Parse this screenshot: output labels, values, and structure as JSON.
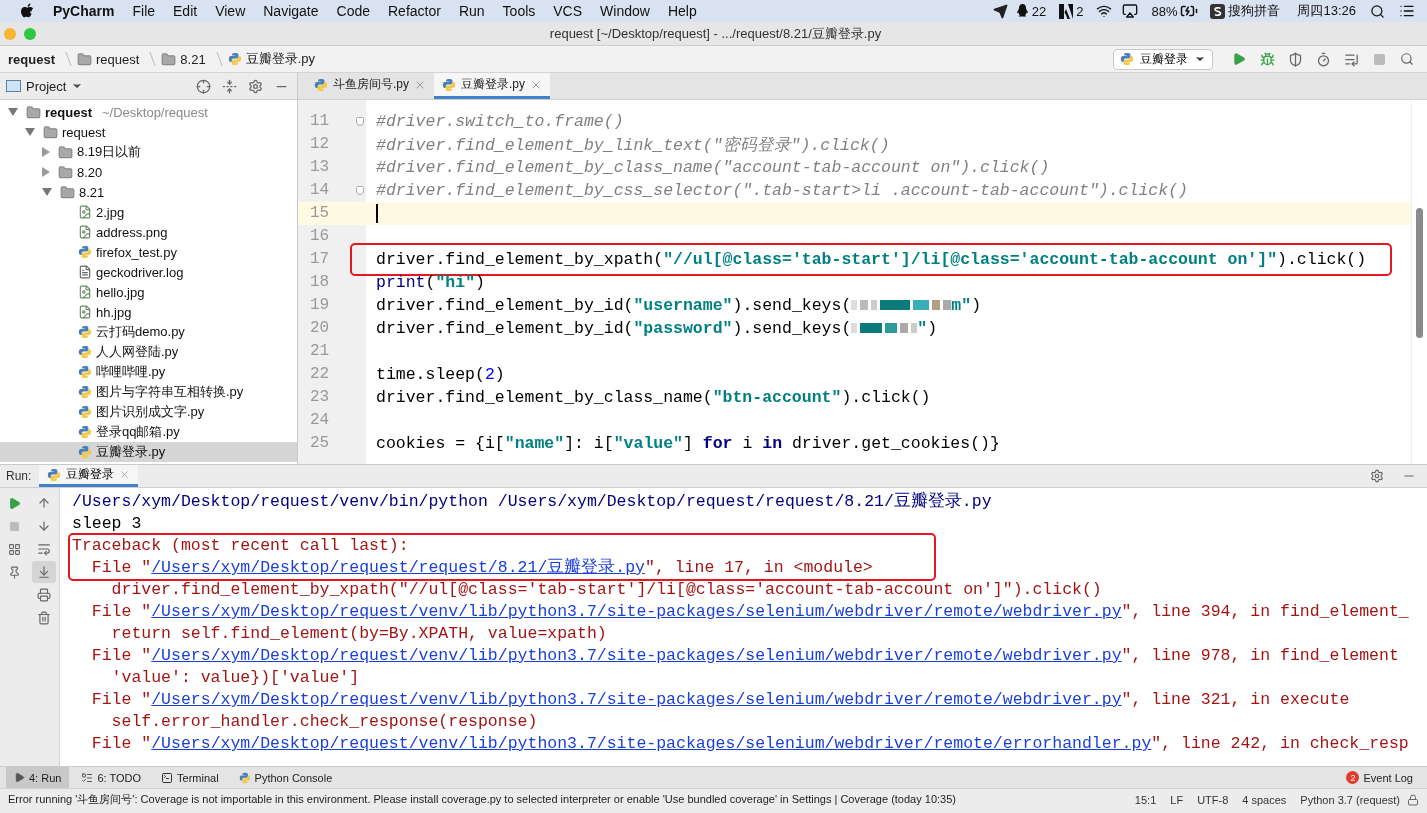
{
  "menu_bar": {
    "app": "PyCharm",
    "menus": [
      "File",
      "Edit",
      "View",
      "Navigate",
      "Code",
      "Refactor",
      "Run",
      "Tools",
      "VCS",
      "Window",
      "Help"
    ],
    "status": {
      "qq_count": "22",
      "adobe_count": "2",
      "battery": "88%",
      "input_method": "搜狗拼音",
      "clock": "周四13:26"
    }
  },
  "window": {
    "title": "request [~/Desktop/request] - .../request/8.21/豆瓣登录.py"
  },
  "breadcrumbs": [
    {
      "label": "request",
      "kind": "project"
    },
    {
      "label": "request",
      "kind": "folder"
    },
    {
      "label": "8.21",
      "kind": "folder"
    },
    {
      "label": "豆瓣登录.py",
      "kind": "python"
    }
  ],
  "run_config": {
    "label": "豆瓣登录"
  },
  "project_panel": {
    "title": "Project",
    "tree": [
      {
        "label": "request",
        "hint": "~/Desktop/request",
        "kind": "folder",
        "expanded": true,
        "selected": false,
        "children": [
          {
            "label": "request",
            "kind": "folder",
            "expanded": true,
            "selected": false,
            "children": [
              {
                "label": "8.19日以前",
                "kind": "folder",
                "expanded": false,
                "selected": false
              },
              {
                "label": "8.20",
                "kind": "folder",
                "expanded": false,
                "selected": false
              },
              {
                "label": "8.21",
                "kind": "folder",
                "expanded": true,
                "selected": false,
                "children": [
                  {
                    "label": "2.jpg",
                    "kind": "image",
                    "selected": false
                  },
                  {
                    "label": "address.png",
                    "kind": "image",
                    "selected": false
                  },
                  {
                    "label": "firefox_test.py",
                    "kind": "python",
                    "selected": false
                  },
                  {
                    "label": "geckodriver.log",
                    "kind": "log",
                    "selected": false
                  },
                  {
                    "label": "hello.jpg",
                    "kind": "image",
                    "selected": false
                  },
                  {
                    "label": "hh.jpg",
                    "kind": "image",
                    "selected": false
                  },
                  {
                    "label": "云打码demo.py",
                    "kind": "python",
                    "selected": false
                  },
                  {
                    "label": "人人网登陆.py",
                    "kind": "python",
                    "selected": false
                  },
                  {
                    "label": "哔哩哔哩.py",
                    "kind": "python",
                    "selected": false
                  },
                  {
                    "label": "图片与字符串互相转换.py",
                    "kind": "python",
                    "selected": false
                  },
                  {
                    "label": "图片识别成文字.py",
                    "kind": "python",
                    "selected": false
                  },
                  {
                    "label": "登录qq邮箱.py",
                    "kind": "python",
                    "selected": false
                  },
                  {
                    "label": "豆瓣登录.py",
                    "kind": "python",
                    "selected": true
                  }
                ]
              }
            ]
          }
        ]
      }
    ]
  },
  "editor": {
    "tabs": [
      {
        "label": "斗鱼房间号.py",
        "selected": false
      },
      {
        "label": "豆瓣登录.py",
        "selected": true
      }
    ],
    "lines": [
      {
        "number": "11",
        "fold": true,
        "current": false,
        "highlighted": false,
        "tokens": [
          {
            "kind": "comment",
            "text": "#driver.switch_to.frame()"
          }
        ]
      },
      {
        "number": "12",
        "fold": false,
        "current": false,
        "highlighted": false,
        "tokens": [
          {
            "kind": "comment",
            "text": "#driver.find_element_by_link_text(\"密码登录\").click()"
          }
        ]
      },
      {
        "number": "13",
        "fold": false,
        "current": false,
        "highlighted": false,
        "tokens": [
          {
            "kind": "comment",
            "text": "#driver.find_element_by_class_name(\"account-tab-account on\").click()"
          }
        ]
      },
      {
        "number": "14",
        "fold": true,
        "current": false,
        "highlighted": false,
        "tokens": [
          {
            "kind": "comment",
            "text": "#driver.find_element_by_css_selector(\".tab-start>li .account-tab-account\").click()"
          }
        ]
      },
      {
        "number": "15",
        "fold": false,
        "current": true,
        "highlighted": false
      },
      {
        "number": "16",
        "fold": false,
        "current": false,
        "highlighted": false
      },
      {
        "number": "17",
        "fold": false,
        "current": false,
        "highlighted": true,
        "tokens": [
          {
            "kind": "text",
            "text": "driver.find_element_by_xpath("
          },
          {
            "kind": "string",
            "text": "\"//ul[@class='tab-start']/li[@class='account-tab-account on']\""
          },
          {
            "kind": "text",
            "text": ").click()"
          }
        ]
      },
      {
        "number": "18",
        "fold": false,
        "current": false,
        "highlighted": false,
        "tokens": [
          {
            "kind": "builtin",
            "text": "print"
          },
          {
            "kind": "text",
            "text": "("
          },
          {
            "kind": "string",
            "text": "\"hi\""
          },
          {
            "kind": "text",
            "text": ")"
          }
        ]
      },
      {
        "number": "19",
        "fold": false,
        "current": false,
        "highlighted": false,
        "tokens": [
          {
            "kind": "text",
            "text": "driver.find_element_by_id("
          },
          {
            "kind": "string",
            "text": "\"username\""
          },
          {
            "kind": "text",
            "text": ").send_keys("
          },
          {
            "kind": "redacted",
            "wide": true
          },
          {
            "kind": "string",
            "text": "m\""
          },
          {
            "kind": "text",
            "text": ")"
          }
        ]
      },
      {
        "number": "20",
        "fold": false,
        "current": false,
        "highlighted": false,
        "tokens": [
          {
            "kind": "text",
            "text": "driver.find_element_by_id("
          },
          {
            "kind": "string",
            "text": "\"password\""
          },
          {
            "kind": "text",
            "text": ").send_keys("
          },
          {
            "kind": "redacted",
            "wide": false
          },
          {
            "kind": "string",
            "text": "\""
          },
          {
            "kind": "text",
            "text": ")"
          }
        ]
      },
      {
        "number": "21",
        "fold": false,
        "current": false,
        "highlighted": false
      },
      {
        "number": "22",
        "fold": false,
        "current": false,
        "highlighted": false,
        "tokens": [
          {
            "kind": "text",
            "text": "time.sleep("
          },
          {
            "kind": "number",
            "text": "2"
          },
          {
            "kind": "text",
            "text": ")"
          }
        ]
      },
      {
        "number": "23",
        "fold": false,
        "current": false,
        "highlighted": false,
        "tokens": [
          {
            "kind": "text",
            "text": "driver.find_element_by_class_name("
          },
          {
            "kind": "string",
            "text": "\"btn-account\""
          },
          {
            "kind": "text",
            "text": ").click()"
          }
        ]
      },
      {
        "number": "24",
        "fold": false,
        "current": false,
        "highlighted": false
      },
      {
        "number": "25",
        "fold": false,
        "current": false,
        "highlighted": false,
        "tokens": [
          {
            "kind": "text",
            "text": "cookies = {i["
          },
          {
            "kind": "string",
            "text": "\"name\""
          },
          {
            "kind": "text",
            "text": "]: i["
          },
          {
            "kind": "string",
            "text": "\"value\""
          },
          {
            "kind": "text",
            "text": "] "
          },
          {
            "kind": "keyword",
            "text": "for"
          },
          {
            "kind": "text",
            "text": " i "
          },
          {
            "kind": "keyword",
            "text": "in"
          },
          {
            "kind": "text",
            "text": " driver.get_cookies()}"
          }
        ]
      }
    ]
  },
  "run_panel": {
    "label": "Run:",
    "tab": {
      "label": "豆瓣登录"
    },
    "lines": [
      {
        "command": true,
        "error": false,
        "highlighted": false,
        "segments": [
          {
            "kind": "plain",
            "text": "/Users/xym/Desktop/request/venv/bin/python /Users/xym/Desktop/request/request/8.21/豆瓣登录.py"
          }
        ]
      },
      {
        "command": false,
        "error": false,
        "highlighted": false,
        "segments": [
          {
            "kind": "plain",
            "text": "sleep 3"
          }
        ]
      },
      {
        "command": false,
        "error": true,
        "highlighted": true,
        "segments": [
          {
            "kind": "plain",
            "text": "Traceback (most recent call last):"
          }
        ]
      },
      {
        "command": false,
        "error": true,
        "highlighted": true,
        "segments": [
          {
            "kind": "plain",
            "text": "  File \""
          },
          {
            "kind": "link",
            "text": "/Users/xym/Desktop/request/request/8.21/豆瓣登录.py"
          },
          {
            "kind": "plain",
            "text": "\", line 17, in <module>"
          }
        ]
      },
      {
        "command": false,
        "error": true,
        "highlighted": false,
        "segments": [
          {
            "kind": "plain",
            "text": "    driver.find_element_by_xpath(\"//ul[@class='tab-start']/li[@class='account-tab-account on']\").click()"
          }
        ]
      },
      {
        "command": false,
        "error": true,
        "highlighted": false,
        "segments": [
          {
            "kind": "plain",
            "text": "  File \""
          },
          {
            "kind": "link",
            "text": "/Users/xym/Desktop/request/venv/lib/python3.7/site-packages/selenium/webdriver/remote/webdriver.py"
          },
          {
            "kind": "plain",
            "text": "\", line 394, in find_element_"
          }
        ]
      },
      {
        "command": false,
        "error": true,
        "highlighted": false,
        "segments": [
          {
            "kind": "plain",
            "text": "    return self.find_element(by=By.XPATH, value=xpath)"
          }
        ]
      },
      {
        "command": false,
        "error": true,
        "highlighted": false,
        "segments": [
          {
            "kind": "plain",
            "text": "  File \""
          },
          {
            "kind": "link",
            "text": "/Users/xym/Desktop/request/venv/lib/python3.7/site-packages/selenium/webdriver/remote/webdriver.py"
          },
          {
            "kind": "plain",
            "text": "\", line 978, in find_element"
          }
        ]
      },
      {
        "command": false,
        "error": true,
        "highlighted": false,
        "segments": [
          {
            "kind": "plain",
            "text": "    'value': value})['value']"
          }
        ]
      },
      {
        "command": false,
        "error": true,
        "highlighted": false,
        "segments": [
          {
            "kind": "plain",
            "text": "  File \""
          },
          {
            "kind": "link",
            "text": "/Users/xym/Desktop/request/venv/lib/python3.7/site-packages/selenium/webdriver/remote/webdriver.py"
          },
          {
            "kind": "plain",
            "text": "\", line 321, in execute"
          }
        ]
      },
      {
        "command": false,
        "error": true,
        "highlighted": false,
        "segments": [
          {
            "kind": "plain",
            "text": "    self.error_handler.check_response(response)"
          }
        ]
      },
      {
        "command": false,
        "error": true,
        "highlighted": false,
        "segments": [
          {
            "kind": "plain",
            "text": "  File \""
          },
          {
            "kind": "link",
            "text": "/Users/xym/Desktop/request/venv/lib/python3.7/site-packages/selenium/webdriver/remote/errorhandler.py"
          },
          {
            "kind": "plain",
            "text": "\", line 242, in check_resp"
          }
        ]
      }
    ]
  },
  "tool_tabs": [
    {
      "label": "4: Run",
      "kind": "run",
      "selected": true
    },
    {
      "label": "6: TODO",
      "kind": "todo",
      "selected": false
    },
    {
      "label": "Terminal",
      "kind": "terminal",
      "selected": false
    },
    {
      "label": "Python Console",
      "kind": "console",
      "selected": false
    }
  ],
  "event_log": {
    "label": "Event Log",
    "count": "2"
  },
  "status_bar": {
    "message": "Error running '斗鱼房间号': Coverage is not importable in this environment. Please install coverage.py to selected interpreter or enable 'Use bundled coverage' in Settings | Coverage (today 10:35)",
    "items": [
      "15:1",
      "LF",
      "UTF-8",
      "4 spaces",
      "Python 3.7 (request)"
    ]
  }
}
